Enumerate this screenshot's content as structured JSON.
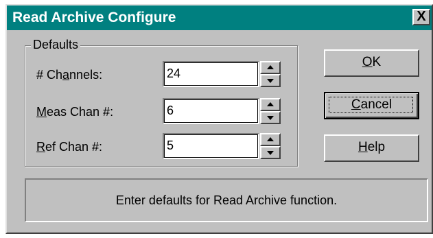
{
  "window": {
    "title": "Read Archive Configure",
    "close_glyph": "X"
  },
  "defaults_group": {
    "label": "Defaults",
    "rows": [
      {
        "label_pre": "# Ch",
        "label_key": "a",
        "label_post": "nnels:",
        "value": "24"
      },
      {
        "label_pre": "",
        "label_key": "M",
        "label_post": "eas Chan #:",
        "value": "6"
      },
      {
        "label_pre": "",
        "label_key": "R",
        "label_post": "ef Chan #:",
        "value": "5"
      }
    ]
  },
  "buttons": {
    "ok": {
      "key": "O",
      "rest": "K"
    },
    "cancel": {
      "key": "C",
      "rest": "ancel"
    },
    "help": {
      "key": "H",
      "rest": "elp"
    }
  },
  "status": {
    "text": "Enter defaults for Read Archive function."
  }
}
